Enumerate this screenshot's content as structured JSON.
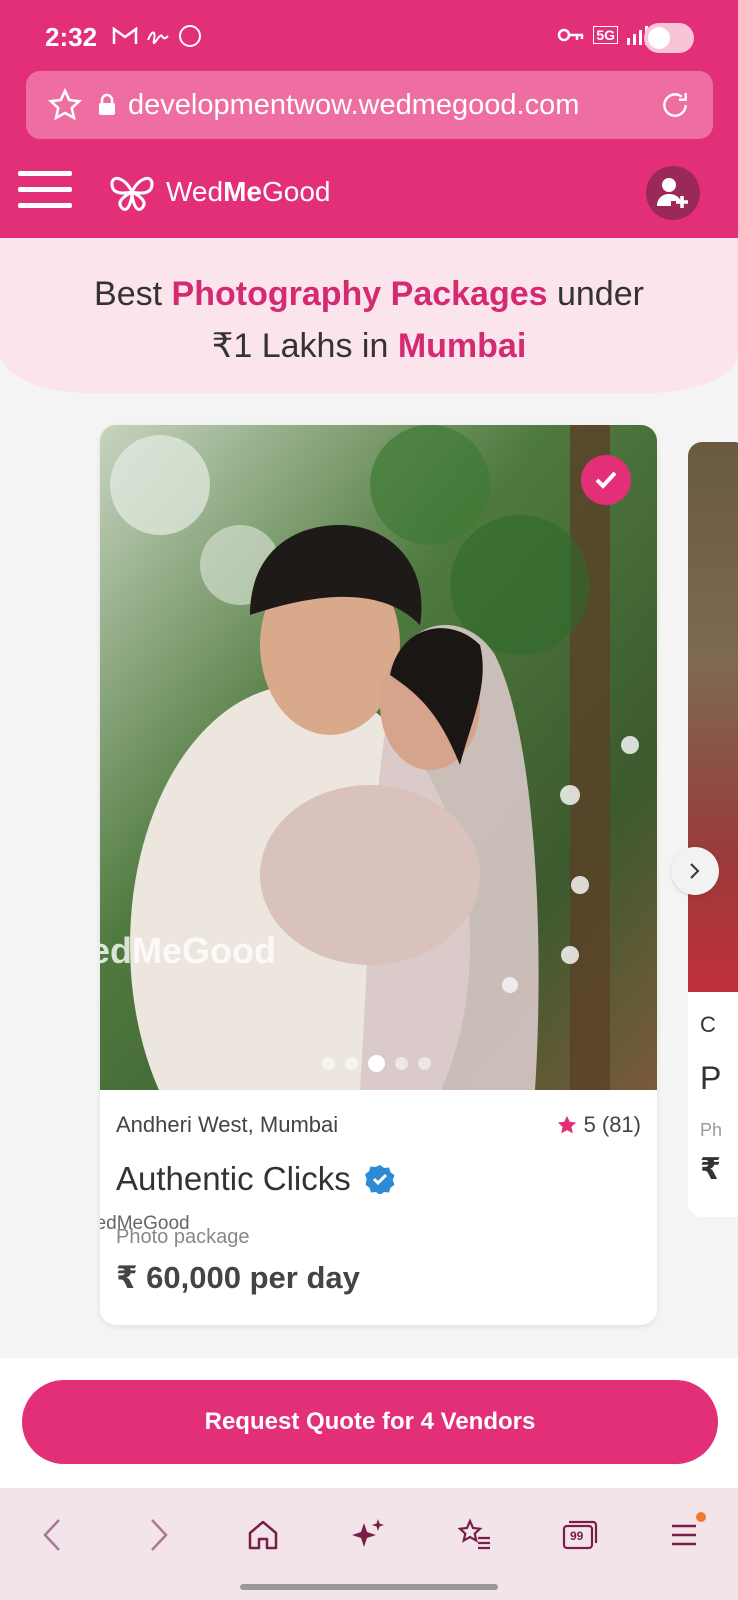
{
  "status_bar": {
    "time": "2:32",
    "network": "5G"
  },
  "url_bar": {
    "url": "developmentwow.wedmegood.com"
  },
  "header": {
    "brand_prefix": "Wed",
    "brand_bold": "Me",
    "brand_suffix": "Good"
  },
  "hero": {
    "t1": "Best ",
    "t2": "Photography Packages",
    "t3": " under",
    "t4": "₹1 Lakhs in ",
    "t5": "Mumbai"
  },
  "card": {
    "image_watermark": "edMeGood",
    "location": "Andheri West, Mumbai",
    "rating": "5",
    "reviews": "(81)",
    "vendor_name": "Authentic Clicks",
    "watermark": "WedMeGood",
    "package_type": "Photo package",
    "price": "₹ 60,000 per day",
    "carousel_total": 5,
    "carousel_active": 3
  },
  "peek_card": {
    "line1": "C",
    "line2": "P",
    "line3": "Ph",
    "line4": "₹"
  },
  "cta": {
    "label": "Request Quote for 4 Vendors"
  },
  "bottom_nav": {
    "tabs_count": "99"
  },
  "colors": {
    "brand": "#e32e78",
    "brand_dark": "#9a2858",
    "hero_bg": "#fbe4ec",
    "verified": "#2d8bd6"
  }
}
